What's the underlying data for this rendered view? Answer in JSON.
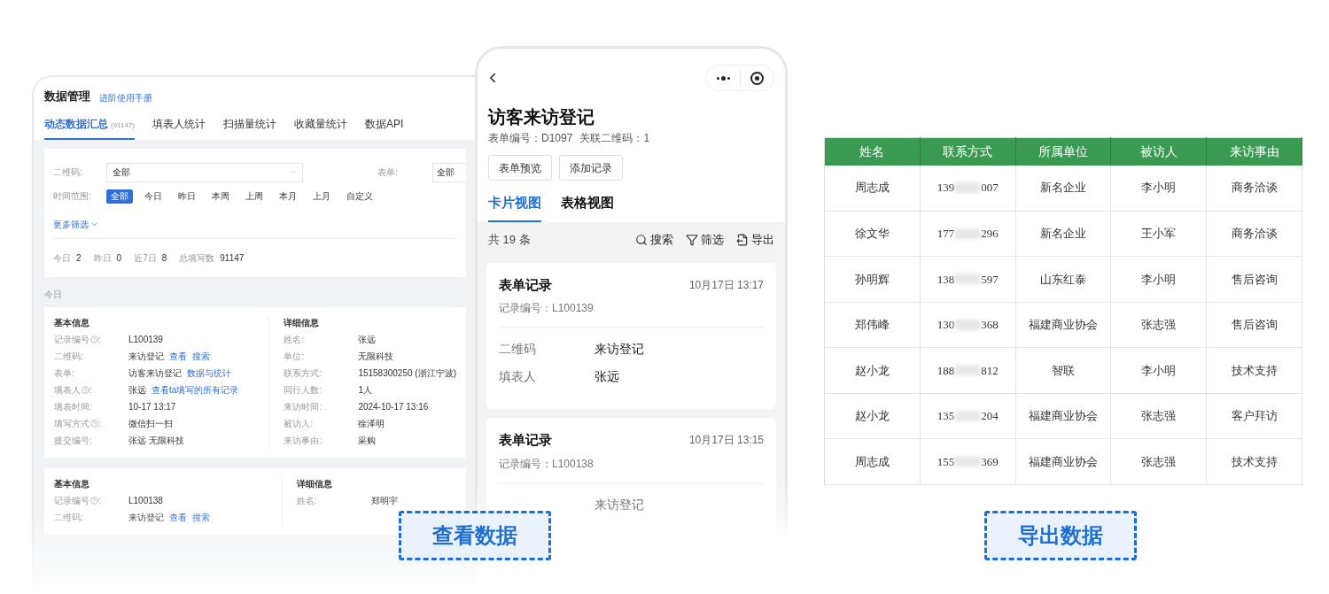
{
  "web": {
    "title": "数据管理",
    "manual_link": "进阶使用手册",
    "tabs": [
      {
        "label": "动态数据汇总",
        "count": "(91147)",
        "selected": true
      },
      {
        "label": "填表人统计",
        "selected": false
      },
      {
        "label": "扫描量统计",
        "selected": false
      },
      {
        "label": "收藏量统计",
        "selected": false
      },
      {
        "label": "数据API",
        "selected": false
      }
    ],
    "filters": {
      "qrcode": {
        "label": "二维码:",
        "value": "全部"
      },
      "form": {
        "label": "表单:",
        "value": "全部"
      },
      "time_label": "时间范围:",
      "time_options": [
        {
          "label": "全部",
          "selected": true
        },
        {
          "label": "今日",
          "selected": false
        },
        {
          "label": "昨日",
          "selected": false
        },
        {
          "label": "本周",
          "selected": false
        },
        {
          "label": "上周",
          "selected": false
        },
        {
          "label": "本月",
          "selected": false
        },
        {
          "label": "上月",
          "selected": false
        },
        {
          "label": "自定义",
          "selected": false
        }
      ],
      "more": "更多筛选"
    },
    "stats": [
      {
        "label": "今日",
        "value": "2"
      },
      {
        "label": "昨日",
        "value": "0"
      },
      {
        "label": "近7日",
        "value": "8"
      },
      {
        "label": "总填写数",
        "value": "91147"
      }
    ],
    "section": "今日",
    "records": [
      {
        "basic_title": "基本信息",
        "detail_title": "详细信息",
        "basic": [
          {
            "label": "记录编号",
            "help": true,
            "colon": ":",
            "value": "L100139"
          },
          {
            "label": "二维码:",
            "value": "来访登记",
            "links": [
              "查看",
              "搜索"
            ]
          },
          {
            "label": "表单:",
            "value": "访客来访登记",
            "links": [
              "数据与统计"
            ]
          },
          {
            "label": "填表人",
            "help": true,
            "colon": ":",
            "value": "张远",
            "links": [
              "查看ta填写的所有记录"
            ]
          },
          {
            "label": "填表时间:",
            "value": "10-17 13:17"
          },
          {
            "label": "填写方式",
            "help": true,
            "colon": ":",
            "value": "微信扫一扫"
          },
          {
            "label": "提交编号:",
            "value": "张远 无限科技"
          }
        ],
        "details": [
          {
            "label": "姓名:",
            "value": "张远"
          },
          {
            "label": "单位:",
            "value": "无限科技"
          },
          {
            "label": "联系方式:",
            "value": "15158300250 (浙江宁波)"
          },
          {
            "label": "同行人数:",
            "value": "1人"
          },
          {
            "label": "来访时间:",
            "value": "2024-10-17 13:16"
          },
          {
            "label": "被访人:",
            "value": "徐泽明"
          },
          {
            "label": "来访事由:",
            "value": "采购"
          }
        ]
      },
      {
        "basic_title": "基本信息",
        "detail_title": "详细信息",
        "basic": [
          {
            "label": "记录编号",
            "help": true,
            "colon": ":",
            "value": "L100138"
          },
          {
            "label": "二维码:",
            "value": "来访登记",
            "links": [
              "查看",
              "搜索"
            ]
          }
        ],
        "details": [
          {
            "label": "姓名:",
            "value": "郑明宇"
          }
        ]
      }
    ]
  },
  "phone": {
    "title": "访客来访登记",
    "meta": [
      "表单编号：D1097",
      "关联二维码：1"
    ],
    "buttons": [
      "表单预览",
      "添加记录"
    ],
    "tabs": [
      {
        "label": "卡片视图",
        "selected": true
      },
      {
        "label": "表格视图",
        "selected": false
      }
    ],
    "count": "共 19 条",
    "actions": [
      {
        "kind": "search",
        "label": "搜索"
      },
      {
        "kind": "filter",
        "label": "筛选"
      },
      {
        "kind": "export",
        "label": "导出"
      }
    ],
    "cards": [
      {
        "title": "表单记录",
        "time": "10月17日 13:17",
        "record_no": "记录编号：L100139",
        "fields": [
          {
            "label": "二维码",
            "value": "来访登记"
          },
          {
            "label": "填表人",
            "value": "张远"
          }
        ]
      },
      {
        "title": "表单记录",
        "time": "10月17日 13:15",
        "record_no": "记录编号：L100138",
        "fields": [
          {
            "value": "来访登记"
          }
        ]
      }
    ]
  },
  "table": {
    "columns": [
      "姓名",
      "联系方式",
      "所属单位",
      "被访人",
      "来访事由"
    ],
    "rows": [
      {
        "name": "周志成",
        "phone_start": "139",
        "phone_end": "007",
        "company": "新名企业",
        "host": "李小明",
        "reason": "商务洽谈"
      },
      {
        "name": "徐文华",
        "phone_start": "177",
        "phone_end": "296",
        "company": "新名企业",
        "host": "王小军",
        "reason": "商务洽谈"
      },
      {
        "name": "孙明辉",
        "phone_start": "138",
        "phone_end": "597",
        "company": "山东红泰",
        "host": "李小明",
        "reason": "售后咨询"
      },
      {
        "name": "郑伟峰",
        "phone_start": "130",
        "phone_end": "368",
        "company": "福建商业协会",
        "host": "张志强",
        "reason": "售后咨询"
      },
      {
        "name": "赵小龙",
        "phone_start": "188",
        "phone_end": "812",
        "company": "智联",
        "host": "李小明",
        "reason": "技术支持"
      },
      {
        "name": "赵小龙",
        "phone_start": "135",
        "phone_end": "204",
        "company": "福建商业协会",
        "host": "张志强",
        "reason": "客户拜访"
      },
      {
        "name": "周志成",
        "phone_start": "155",
        "phone_end": "369",
        "company": "福建商业协会",
        "host": "张志强",
        "reason": "技术支持"
      }
    ]
  },
  "captions": [
    "查看数据",
    "导出数据"
  ]
}
